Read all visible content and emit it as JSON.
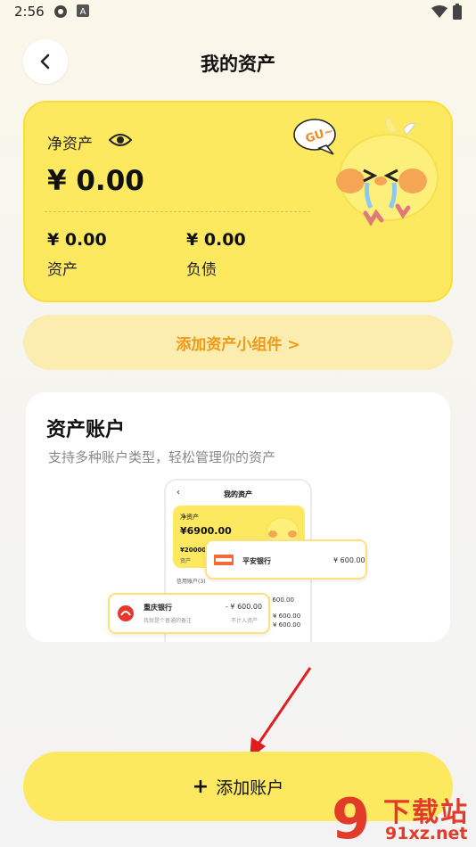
{
  "status_bar": {
    "time": "2:56",
    "icons": [
      "location-icon",
      "a-badge-icon",
      "wifi-icon",
      "battery-icon"
    ]
  },
  "header": {
    "title": "我的资产",
    "back_icon": "chevron-left-icon"
  },
  "asset_card": {
    "net_label": "净资产",
    "net_value": "¥ 0.00",
    "assets_value": "¥ 0.00",
    "assets_label": "资产",
    "liabilities_value": "¥ 0.00",
    "liabilities_label": "负债",
    "mascot_bubble": "GU~",
    "accent_color": "#fde960"
  },
  "widget_button": {
    "label": "添加资产小组件 >",
    "color": "#f09a18"
  },
  "account_section": {
    "title": "资产账户",
    "description": "支持多种账户类型，轻松管理你的资产",
    "preview": {
      "title": "我的资产",
      "net_label": "净资产",
      "net_value": "¥6900.00",
      "sub_value": "¥20000",
      "sub_label": "资产",
      "credit_label": "信用账户(3)",
      "amount_1": "- ¥ 600.00",
      "amount_2": "¥ 600.00",
      "amount_3": "¥ 600.00",
      "card_1": {
        "name": "平安银行",
        "amount": "¥ 600.00"
      },
      "card_2": {
        "name": "重庆银行",
        "note": "我就是个普通的备注",
        "amount": "- ¥ 600.00",
        "note_right": "不计入资产"
      }
    }
  },
  "add_button": {
    "icon": "plus-icon",
    "label": "添加账户"
  },
  "watermark": {
    "text": "下载站",
    "url": "91xz.net",
    "logo": "9"
  }
}
